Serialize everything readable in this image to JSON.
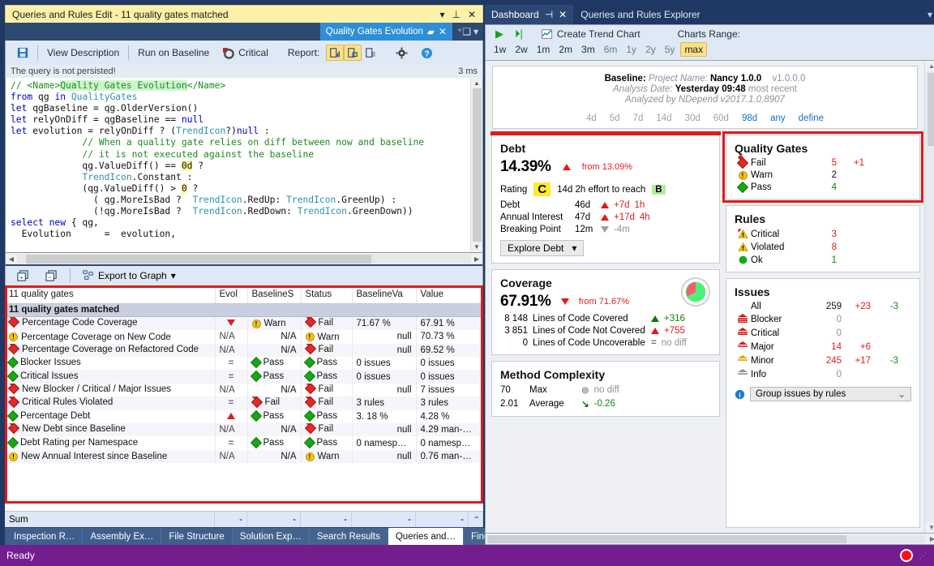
{
  "left": {
    "window_title": "Queries and Rules Edit  - 11 quality gates matched",
    "doc_tab": "Quality Gates Evolution",
    "toolbar": {
      "save_icon": "floppy-disk-icon",
      "view_description": "View Description",
      "run_on_baseline": "Run on Baseline",
      "critical": "Critical",
      "report_label": "Report:",
      "gear_icon": "gear-icon",
      "help_icon": "help-icon"
    },
    "status": {
      "message": "The query is not persisted!",
      "time": "3 ms"
    },
    "code": {
      "lines": [
        "// <Name>Quality Gates Evolution</Name>",
        "from qg in QualityGates",
        "let qgBaseline = qg.OlderVersion()",
        "let relyOnDiff = qgBaseline == null",
        "let evolution = relyOnDiff ? (TrendIcon?)null :",
        "             // When a quality gate relies on diff between now and baseline",
        "             // it is not executed against the baseline",
        "             qg.ValueDiff() == 0d ?",
        "             TrendIcon.Constant :",
        "             (qg.ValueDiff() > 0 ?",
        "               ( qg.MoreIsBad ?  TrendIcon.RedUp: TrendIcon.GreenUp) :",
        "               (!qg.MoreIsBad ?  TrendIcon.RedDown: TrendIcon.GreenDown))",
        "select new { qg,",
        "  Evolution      =  evolution,"
      ]
    },
    "results_toolbar": {
      "expand_icon": "expand-all-icon",
      "collapse_icon": "collapse-all-icon",
      "export": "Export to Graph"
    },
    "grid": {
      "headers": [
        "11 quality gates",
        "Evol",
        "BaselineS",
        "Status",
        "BaselineVa",
        "Value"
      ],
      "group_row": "11 quality gates matched",
      "rows": [
        {
          "icon": "fail",
          "name": "Percentage Code Coverage",
          "evol": "down",
          "baseline_status": "Warn",
          "bs_icon": "warn",
          "status": "Fail",
          "st_icon": "fail",
          "baseline_value": "71.67 %",
          "value": "67.91 %"
        },
        {
          "icon": "warn",
          "name": "Percentage Coverage on New Code",
          "evol": "N/A",
          "baseline_status": "N/A",
          "bs_icon": "",
          "status": "Warn",
          "st_icon": "warn",
          "baseline_value": "null",
          "value": "70.73 %"
        },
        {
          "icon": "fail",
          "name": "Percentage Coverage on Refactored Code",
          "evol": "N/A",
          "baseline_status": "N/A",
          "bs_icon": "",
          "status": "Fail",
          "st_icon": "fail",
          "baseline_value": "null",
          "value": "69.52 %"
        },
        {
          "icon": "pass",
          "name": "Blocker Issues",
          "evol": "eq",
          "baseline_status": "Pass",
          "bs_icon": "pass",
          "status": "Pass",
          "st_icon": "pass",
          "baseline_value": "0 issues",
          "value": "0 issues"
        },
        {
          "icon": "pass",
          "name": "Critical Issues",
          "evol": "eq",
          "baseline_status": "Pass",
          "bs_icon": "pass",
          "status": "Pass",
          "st_icon": "pass",
          "baseline_value": "0 issues",
          "value": "0 issues"
        },
        {
          "icon": "fail",
          "name": "New Blocker / Critical / Major Issues",
          "evol": "N/A",
          "baseline_status": "N/A",
          "bs_icon": "",
          "status": "Fail",
          "st_icon": "fail",
          "baseline_value": "null",
          "value": "7 issues"
        },
        {
          "icon": "fail",
          "name": "Critical Rules Violated",
          "evol": "eq",
          "baseline_status": "Fail",
          "bs_icon": "fail",
          "status": "Fail",
          "st_icon": "fail",
          "baseline_value": "3 rules",
          "value": "3 rules"
        },
        {
          "icon": "pass",
          "name": "Percentage Debt",
          "evol": "up",
          "baseline_status": "Pass",
          "bs_icon": "pass",
          "status": "Pass",
          "st_icon": "pass",
          "baseline_value": "3. 18 %",
          "value": "4.28 %"
        },
        {
          "icon": "fail",
          "name": "New Debt since Baseline",
          "evol": "N/A",
          "baseline_status": "N/A",
          "bs_icon": "",
          "status": "Fail",
          "st_icon": "fail",
          "baseline_value": "null",
          "value": "4.29 man-…"
        },
        {
          "icon": "pass",
          "name": "Debt Rating per Namespace",
          "evol": "eq",
          "baseline_status": "Pass",
          "bs_icon": "pass",
          "status": "Pass",
          "st_icon": "pass",
          "baseline_value": "0 namesp…",
          "value": "0 namesp…"
        },
        {
          "icon": "warn",
          "name": "New Annual Interest since Baseline",
          "evol": "N/A",
          "baseline_status": "N/A",
          "bs_icon": "",
          "status": "Warn",
          "st_icon": "warn",
          "baseline_value": "null",
          "value": "0.76 man-…"
        }
      ],
      "sum_label": "Sum",
      "sum_values": [
        "-",
        "-",
        "-",
        "-",
        "-"
      ]
    },
    "bottom_tabs": [
      {
        "label": "Inspection R…",
        "selected": false
      },
      {
        "label": "Assembly Ex…",
        "selected": false
      },
      {
        "label": "File Structure",
        "selected": false
      },
      {
        "label": "Solution Exp…",
        "selected": false
      },
      {
        "label": "Search Results",
        "selected": false
      },
      {
        "label": "Queries and…",
        "selected": true
      },
      {
        "label": "Find Results",
        "selected": false
      }
    ]
  },
  "right": {
    "tabs": {
      "active": "Dashboard",
      "other": "Queries and Rules Explorer"
    },
    "toolbar": {
      "run_icon": "play-icon",
      "run_import_icon": "play-import-icon",
      "create_trend_chart": "Create Trend Chart",
      "charts_range_label": "Charts Range:",
      "ranges": [
        {
          "label": "1w",
          "state": "active"
        },
        {
          "label": "2w",
          "state": "active"
        },
        {
          "label": "1m",
          "state": "active"
        },
        {
          "label": "2m",
          "state": "active"
        },
        {
          "label": "3m",
          "state": "active"
        },
        {
          "label": "6m",
          "state": "dim"
        },
        {
          "label": "1y",
          "state": "dim"
        },
        {
          "label": "2y",
          "state": "dim"
        },
        {
          "label": "5y",
          "state": "dim"
        },
        {
          "label": "max",
          "state": "selected"
        }
      ]
    },
    "baseline": {
      "label": "Baseline:",
      "project_name_label": "Project Name:",
      "project_name": "Nancy 1.0.0",
      "version": "v1.0.0.0",
      "analysis_date_label": "Analysis Date:",
      "analysis_date": "Yesterday 09:48",
      "most_recent": "most recent",
      "analyzed_by": "Analyzed by NDepend v2017.1.0.8907",
      "days": [
        {
          "label": "4d",
          "state": "dim"
        },
        {
          "label": "5d",
          "state": "dim"
        },
        {
          "label": "7d",
          "state": "dim"
        },
        {
          "label": "14d",
          "state": "dim"
        },
        {
          "label": "30d",
          "state": "dim"
        },
        {
          "label": "60d",
          "state": "dim"
        },
        {
          "label": "98d",
          "state": "on"
        },
        {
          "label": "any",
          "state": "link"
        },
        {
          "label": "define",
          "state": "link"
        }
      ]
    },
    "debt": {
      "title": "Debt",
      "value": "14.39%",
      "trend_dir": "up",
      "trend_text": "from 13.09%",
      "rating_label": "Rating",
      "rating": "C",
      "effort_text": "14d 2h effort to reach",
      "target_rating": "B",
      "rows": [
        {
          "label": "Debt",
          "value": "46d",
          "dir": "up",
          "delta": "+7d",
          "extra": "1h"
        },
        {
          "label": "Annual Interest",
          "value": "47d",
          "dir": "up",
          "delta": "+17d",
          "extra": "4h"
        },
        {
          "label": "Breaking Point",
          "value": "12m",
          "dir": "down-grey",
          "delta": "-4m",
          "extra": ""
        }
      ],
      "explore_button": "Explore Debt"
    },
    "coverage": {
      "title": "Coverage",
      "value": "67.91%",
      "trend_dir": "down",
      "trend_text": "from 71.67%",
      "rows": [
        {
          "num": "8 148",
          "label": "Lines of Code Covered",
          "dir": "up-green",
          "delta": "+316"
        },
        {
          "num": "3 851",
          "label": "Lines of Code Not Covered",
          "dir": "up-red",
          "delta": "+755"
        },
        {
          "num": "0",
          "label": "Lines of Code Uncoverable",
          "dir": "eq",
          "delta": "no diff"
        }
      ],
      "pie_covered_pct": 68
    },
    "complexity": {
      "title": "Method Complexity",
      "rows": [
        {
          "num": "70",
          "label": "Max",
          "dir": "eq",
          "delta": "no diff"
        },
        {
          "num": "2.01",
          "label": "Average",
          "dir": "down-green",
          "delta": "-0.26"
        }
      ]
    },
    "quality_gates": {
      "title": "Quality Gates",
      "rows": [
        {
          "icon": "fail",
          "label": "Fail",
          "count": "5",
          "delta": "+1",
          "color": "#e21b1b"
        },
        {
          "icon": "warn",
          "label": "Warn",
          "count": "2",
          "delta": "",
          "color": "#111111"
        },
        {
          "icon": "pass",
          "label": "Pass",
          "count": "4",
          "delta": "",
          "color": "#0a8a0a"
        }
      ]
    },
    "rules": {
      "title": "Rules",
      "rows": [
        {
          "icon": "critical-rule",
          "label": "Critical",
          "count": "3",
          "color": "#e21b1b"
        },
        {
          "icon": "violated-rule",
          "label": "Violated",
          "count": "8",
          "color": "#e21b1b"
        },
        {
          "icon": "ok-rule",
          "label": "Ok",
          "count": "1",
          "color": "#0a8a0a"
        }
      ]
    },
    "issues": {
      "title": "Issues",
      "rows": [
        {
          "icon": "",
          "label": "All",
          "count": "259",
          "c_color": "#111111",
          "d1": "+23",
          "d1_color": "#e21b1b",
          "d2": "-3",
          "d2_color": "#0a8a0a"
        },
        {
          "icon": "blocker",
          "label": "Blocker",
          "count": "0",
          "c_color": "#8b929c",
          "d1": "",
          "d1_color": "",
          "d2": "",
          "d2_color": ""
        },
        {
          "icon": "critical",
          "label": "Critical",
          "count": "0",
          "c_color": "#8b929c",
          "d1": "",
          "d1_color": "",
          "d2": "",
          "d2_color": ""
        },
        {
          "icon": "major",
          "label": "Major",
          "count": "14",
          "c_color": "#e21b1b",
          "d1": "+6",
          "d1_color": "#e21b1b",
          "d2": "",
          "d2_color": ""
        },
        {
          "icon": "minor",
          "label": "Minor",
          "count": "245",
          "c_color": "#e21b1b",
          "d1": "+17",
          "d1_color": "#e21b1b",
          "d2": "-3",
          "d2_color": "#0a8a0a"
        },
        {
          "icon": "info",
          "label": "Info",
          "count": "0",
          "c_color": "#8b929c",
          "d1": "",
          "d1_color": "",
          "d2": "",
          "d2_color": ""
        }
      ],
      "group_select": "Group issues by rules",
      "info_icon": "info-icon"
    }
  },
  "statusbar": {
    "text": "Ready",
    "rec_icon": "record-dot-icon"
  },
  "colors": {
    "title_yellow": "#fdf0a9",
    "accent_blue": "#2d8fd5",
    "panel_navy": "#203864",
    "status_purple": "#741d8f",
    "highlight_box_red": "#e01b1b",
    "fail_red": "#e21b1b",
    "pass_green": "#16a816",
    "warn_yellow": "#f3c51a"
  }
}
